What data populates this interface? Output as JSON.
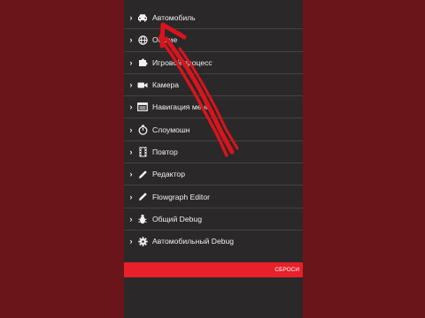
{
  "menu": {
    "items": [
      {
        "label": "Автомобиль",
        "icon": "car-icon"
      },
      {
        "label": "Общие",
        "icon": "globe-icon"
      },
      {
        "label": "Игровой процесс",
        "icon": "puzzle-icon"
      },
      {
        "label": "Камера",
        "icon": "video-camera-icon"
      },
      {
        "label": "Навигация меню",
        "icon": "menu-navigation-icon"
      },
      {
        "label": "Слоумошн",
        "icon": "stopwatch-icon"
      },
      {
        "label": "Повтор",
        "icon": "film-icon"
      },
      {
        "label": "Редактор",
        "icon": "pencil-icon"
      },
      {
        "label": "Flowgraph Editor",
        "icon": "pencil-icon"
      },
      {
        "label": "Общий Debug",
        "icon": "bug-icon"
      },
      {
        "label": "Автомобильный Debug",
        "icon": "gear-icon"
      }
    ]
  },
  "reset_button": {
    "label": "СБРОСИ"
  },
  "colors": {
    "background": "#6a1519",
    "panel": "#2a2829",
    "accent": "#e8202a",
    "annotation": "#d8141c"
  }
}
